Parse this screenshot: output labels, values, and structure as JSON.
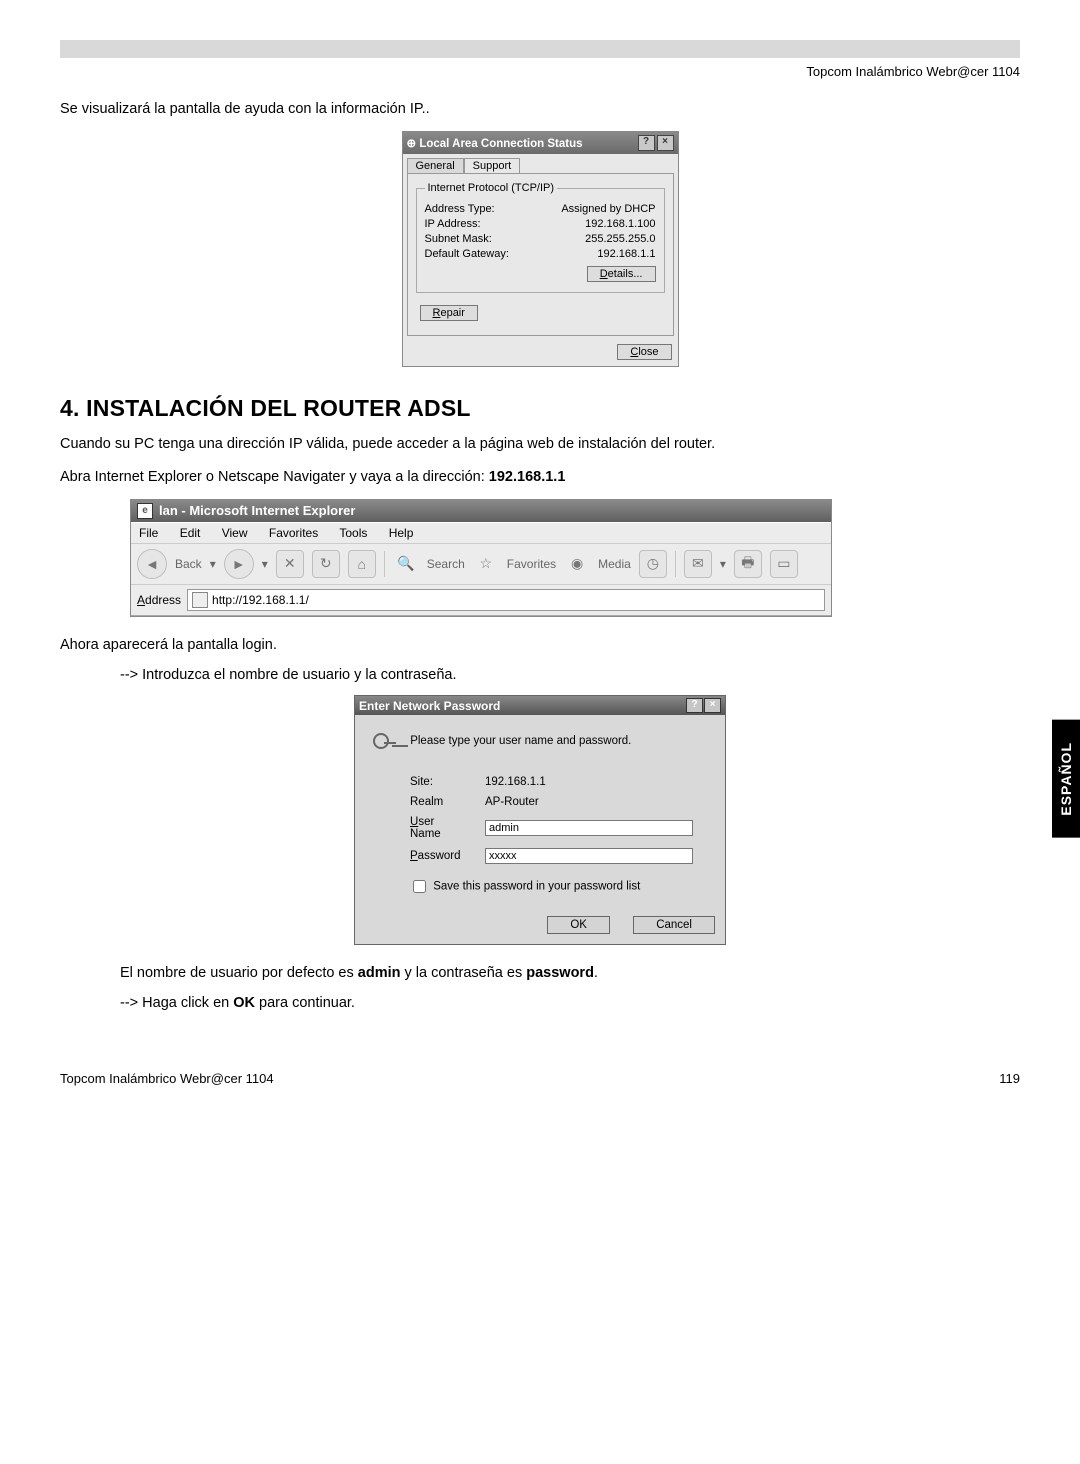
{
  "header": {
    "right": "Topcom Inalámbrico Webr@cer 1104"
  },
  "intro_text": "Se visualizará la pantalla de ayuda con la información IP..",
  "status_dialog": {
    "title": "Local Area Connection Status",
    "tabs": {
      "general": "General",
      "support": "Support"
    },
    "group_label": "Internet Protocol (TCP/IP)",
    "rows": {
      "addr_type_label": "Address Type:",
      "addr_type_value": "Assigned by DHCP",
      "ip_label": "IP Address:",
      "ip_value": "192.168.1.100",
      "mask_label": "Subnet Mask:",
      "mask_value": "255.255.255.0",
      "gw_label": "Default Gateway:",
      "gw_value": "192.168.1.1"
    },
    "details_btn": "Details...",
    "repair_btn": "Repair",
    "close_btn": "Close"
  },
  "section_title": "4. INSTALACIÓN DEL ROUTER ADSL",
  "para1": "Cuando su PC tenga una dirección IP válida, puede acceder a la página web de instalación del router.",
  "para2_pre": "Abra Internet Explorer o Netscape Navigater y vaya a la dirección: ",
  "para2_bold": "192.168.1.1",
  "ie": {
    "title": "lan - Microsoft Internet Explorer",
    "menus": {
      "file": "File",
      "edit": "Edit",
      "view": "View",
      "fav": "Favorites",
      "tools": "Tools",
      "help": "Help"
    },
    "back": "Back",
    "search": "Search",
    "favorites_btn": "Favorites",
    "media": "Media",
    "address_label": "Address",
    "url": "http://192.168.1.1/"
  },
  "para3": "Ahora aparecerá la pantalla login.",
  "bullet1": "Introduzca el nombre de usuario y la contraseña.",
  "pwdlg": {
    "title": "Enter Network Password",
    "msg": "Please type your user name and password.",
    "site_label": "Site:",
    "site_value": "192.168.1.1",
    "realm_label": "Realm",
    "realm_value": "AP-Router",
    "user_label": "User Name",
    "user_value": "admin",
    "pass_label": "Password",
    "pass_value": "xxxxx",
    "save_label": "Save this password in your password list",
    "ok": "OK",
    "cancel": "Cancel"
  },
  "para4_pre": "El nombre de usuario por defecto es ",
  "para4_b1": "admin",
  "para4_mid": " y la contraseña es ",
  "para4_b2": "password",
  "para4_post": ".",
  "bullet2_pre": "Haga click en ",
  "bullet2_bold": "OK",
  "bullet2_post": " para continuar.",
  "side_tab": "ESPAÑOL",
  "footer": {
    "left": "Topcom Inalámbrico Webr@cer 1104",
    "right": "119"
  }
}
